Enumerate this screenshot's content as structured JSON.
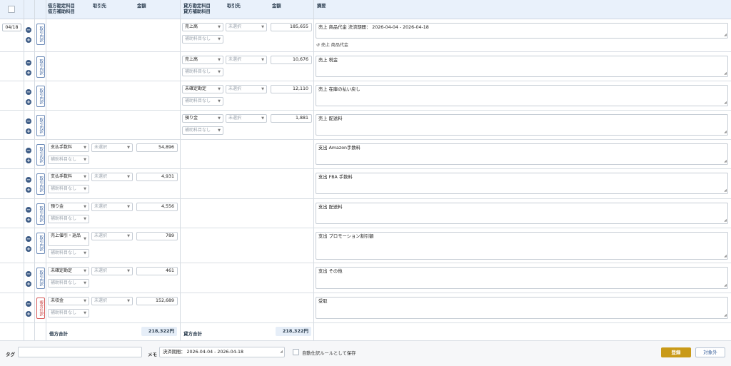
{
  "header": {
    "debit_account": "借方勘定科目",
    "debit_sub": "借方補助科目",
    "debit_partner": "取引先",
    "debit_amount": "金額",
    "credit_account": "貸方勘定科目",
    "credit_sub": "貸方補助科目",
    "credit_partner": "取引先",
    "credit_amount": "金額",
    "memo": "摘要"
  },
  "date": "04/18",
  "labels": {
    "detail_btn": "取引内訳",
    "multi_btn": "複合仕訳",
    "unselected": "未選択",
    "no_sub": "補助科目なし"
  },
  "rows": [
    {
      "credit_account": "売上高",
      "credit_amount": "185,655",
      "memo": "売上 商品代金 決済期間： 2026-04-04 - 2026-04-18",
      "hint": "売上 商品代金"
    },
    {
      "credit_account": "売上高",
      "credit_amount": "10,676",
      "memo": "売上 税金"
    },
    {
      "credit_account": "未確定勘定",
      "credit_amount": "12,110",
      "memo": "売上 在庫の払い戻し"
    },
    {
      "credit_account": "預り金",
      "credit_amount": "1,881",
      "memo": "売上 配送料"
    },
    {
      "debit_account": "支払手数料",
      "debit_amount": "54,896",
      "memo": "支出 Amazon手数料"
    },
    {
      "debit_account": "支払手数料",
      "debit_amount": "4,931",
      "memo": "支出 FBA 手数料"
    },
    {
      "debit_account": "預り金",
      "debit_amount": "4,556",
      "memo": "支出 配送料"
    },
    {
      "debit_account": "売上値引・返品",
      "debit_amount": "789",
      "memo": "支出 プロモーション割引額"
    },
    {
      "debit_account": "未確定勘定",
      "debit_amount": "461",
      "memo": "支出 その他"
    },
    {
      "debit_account": "未収金",
      "debit_amount": "152,689",
      "memo": "受取"
    }
  ],
  "totals": {
    "debit_label": "借方合計",
    "debit_value": "218,322円",
    "credit_label": "貸方合計",
    "credit_value": "218,322円"
  },
  "footer": {
    "tag_label": "タグ",
    "tag_value": "",
    "memo_label": "メモ",
    "memo_value": "決済期間： 2026-04-04 - 2026-04-18",
    "auto_rule_label": "自動仕訳ルールとして保存",
    "register_button": "登録",
    "exclude_button": "対象外"
  },
  "colors": {
    "header_bg": "#e9f1fb",
    "accent_gold": "#c99a18",
    "icon_blue": "#3b5a85",
    "multi_red": "#c94040"
  }
}
